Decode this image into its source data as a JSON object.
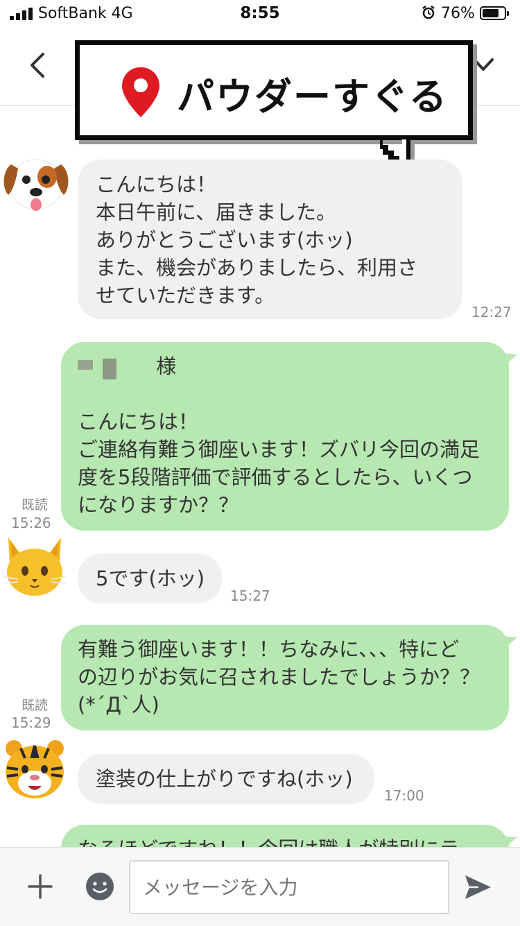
{
  "status_bar": {
    "carrier": "SoftBank  4G",
    "time": "8:55",
    "battery_percent": "76%",
    "battery_level": 0.76
  },
  "header": {
    "title": "パウダーすぐる"
  },
  "messages": [
    {
      "direction": "incoming",
      "avatar": "dog-emoji-avatar",
      "lines": [
        "こんにちは！",
        "本日午前に、届きました。",
        "ありがとうございます(ホッ)",
        "また、機会がありましたら、利用さ",
        "せていただきます。"
      ],
      "time": "12:27"
    },
    {
      "direction": "outgoing",
      "lines": [
        "様",
        "",
        "こんにちは！",
        "ご連絡有難う御座います！ズバリ今回の満足",
        "度を5段階評価で評価するとしたら、いくつ",
        "になりますか？？"
      ],
      "read": "既読",
      "time": "15:26"
    },
    {
      "direction": "incoming",
      "avatar": "cat-emoji-avatar",
      "lines": [
        "5です(ホッ)"
      ],
      "time": "15:27"
    },
    {
      "direction": "outgoing",
      "lines": [
        "有難う御座います！！ちなみに、、、特にど",
        "の辺りがお気に召されましたでしょうか？？",
        "(*´Д`人)"
      ],
      "read": "既読",
      "time": "15:29"
    },
    {
      "direction": "incoming",
      "avatar": "tiger-emoji-avatar",
      "lines": [
        "塗装の仕上がりですね(ホッ)"
      ],
      "time": "17:00"
    },
    {
      "direction": "outgoing",
      "lines": [
        "なるほどですね！！今回は職人が特別にラ"
      ]
    }
  ],
  "composer": {
    "placeholder": "メッセージを入力"
  },
  "icons": {
    "back": "chevron-left-icon",
    "menu": "chevron-down-icon",
    "pin": "map-pin-icon",
    "add": "plus-icon",
    "emoji": "emoji-icon",
    "send": "send-icon"
  },
  "colors": {
    "outgoing_bubble": "#b7e8b2",
    "incoming_bubble": "#eff0f2",
    "pin_red": "#e01a22"
  }
}
